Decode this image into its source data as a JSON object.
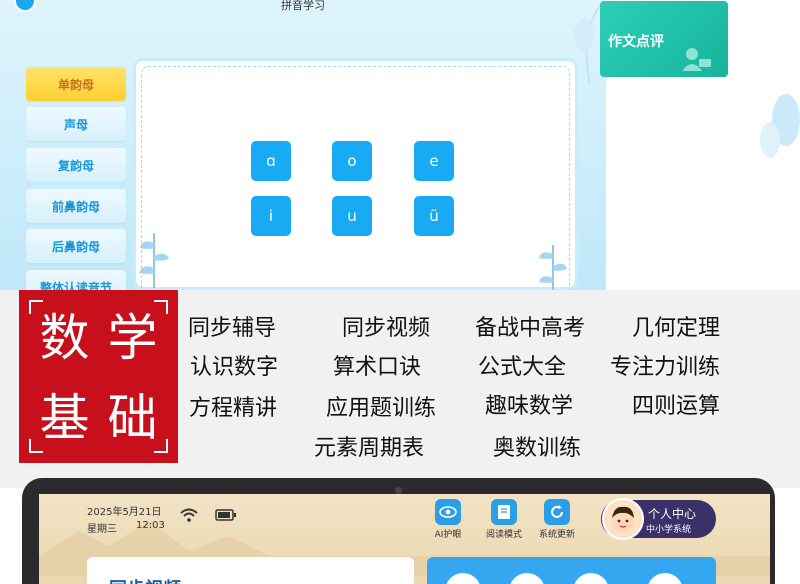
{
  "pinyin_app": {
    "title": "拼音学习",
    "tabs": [
      {
        "label": "单韵母",
        "active": true
      },
      {
        "label": "声母",
        "active": false
      },
      {
        "label": "复韵母",
        "active": false
      },
      {
        "label": "前鼻韵母",
        "active": false
      },
      {
        "label": "后鼻韵母",
        "active": false
      },
      {
        "label": "整体认读音节",
        "active": false
      }
    ],
    "letters": [
      "ɑ",
      "o",
      "e",
      "i",
      "u",
      "ü"
    ],
    "essay_card_label": "作文点评",
    "colors": {
      "accent": "#19aaf4",
      "active_tab": "#ffcf32",
      "essay_card": "#22c3aa"
    }
  },
  "math_banner": {
    "badge_text": [
      "数学",
      "基础"
    ],
    "badge_color": "#c8101c",
    "courses": [
      "同步辅导",
      "同步视频",
      "备战中高考",
      "几何定理",
      "认识数字",
      "算术口诀",
      "公式大全",
      "专注力训练",
      "方程精讲",
      "应用题训练",
      "趣味数学",
      "四则运算",
      "元素周期表",
      "奥数训练"
    ]
  },
  "tablet": {
    "date": "2025年5月21日",
    "weekday": "星期三",
    "time": "12:03",
    "tools": [
      {
        "label": "AI护眼",
        "icon": "eye-icon"
      },
      {
        "label": "阅读模式",
        "icon": "book-icon"
      },
      {
        "label": "系统更新",
        "icon": "refresh-icon"
      }
    ],
    "profile": {
      "name": "个人中心",
      "subtitle": "中小学系统"
    },
    "sync_card_title": "同步视频"
  }
}
